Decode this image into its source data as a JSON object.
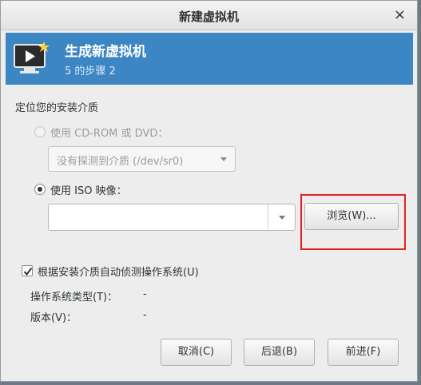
{
  "window": {
    "title": "新建虚拟机",
    "close_glyph": "×"
  },
  "banner": {
    "title": "生成新虚拟机",
    "step": "5 的步骤 2"
  },
  "install": {
    "section_label": "定位您的安装介质",
    "cdrom_label": "使用 CD-ROM 或 DVD：",
    "cdrom_selected": false,
    "cdrom_combo_value": "没有探测到介质 (/dev/sr0)",
    "iso_label": "使用 ISO 映像：",
    "iso_selected": true,
    "iso_value": "",
    "browse_label": "浏览(W)...",
    "auto_detect_label": "根据安装介质自动侦测操作系统(U)",
    "auto_detect_checked": true,
    "os_type_label": "操作系统类型(T)：",
    "os_type_value": "-",
    "version_label": "版本(V)：",
    "version_value": "-"
  },
  "buttons": {
    "cancel": "取消(C)",
    "back": "后退(B)",
    "forward": "前进(F)"
  },
  "colors": {
    "banner": "#3d86c4",
    "highlight": "#e62020"
  },
  "icons": {
    "banner": "monitor-play-icon"
  }
}
